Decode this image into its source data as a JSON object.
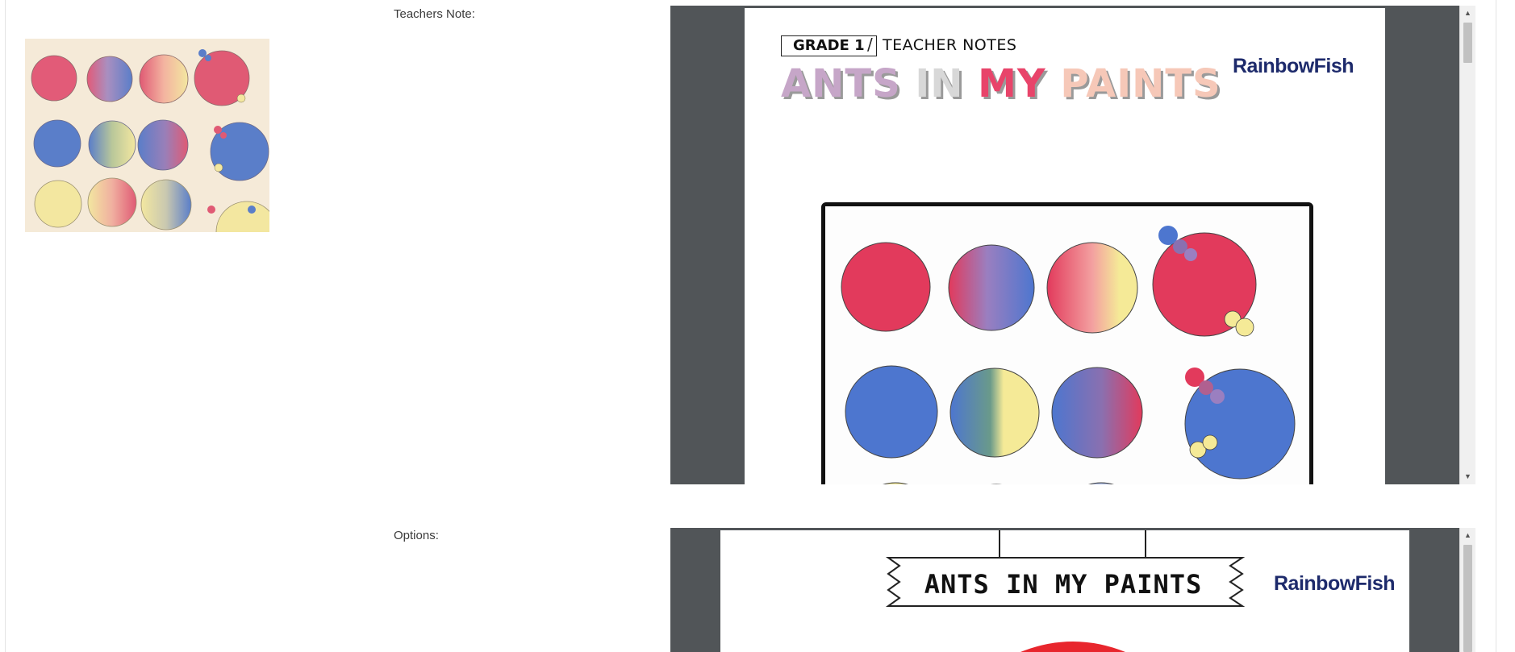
{
  "form": {
    "teachers_note_label": "Teachers Note:",
    "options_label": "Options:"
  },
  "thumbnail": {
    "name": "watercolor circles with ants"
  },
  "doc1": {
    "grade": "GRADE 1",
    "subtitle": "TEACHER NOTES",
    "title_words": [
      "ANTS",
      "IN",
      "MY",
      "PAINTS"
    ],
    "title_colors": [
      "#c6a6c8",
      "#d8d8d8",
      "#e8446a",
      "#f6c8b8"
    ],
    "brand": "RainbowFish"
  },
  "doc2": {
    "banner_title": "ANTS IN MY PAINTS",
    "brand": "RainbowFish"
  },
  "colors": {
    "viewer_bg": "#515558",
    "red": "#e23a5c",
    "blue": "#4d76cf",
    "yellow": "#f5ea97",
    "brand": "#1d2a6b"
  }
}
